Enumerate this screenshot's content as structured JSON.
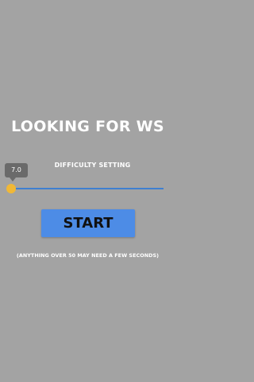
{
  "screen": {
    "title": "LOOKING FOR WS",
    "difficulty_label": "DIFFICULTY SETTING",
    "slider": {
      "value_text": "7.0",
      "value": 7.0,
      "accent_color": "#3f7fd0",
      "thumb_color": "#f1b836"
    },
    "start_button_label": "START",
    "note": "(ANYTHING OVER 50 MAY NEED A FEW SECONDS)",
    "background_color": "#a3a3a3",
    "button_color": "#4d8ce6"
  }
}
